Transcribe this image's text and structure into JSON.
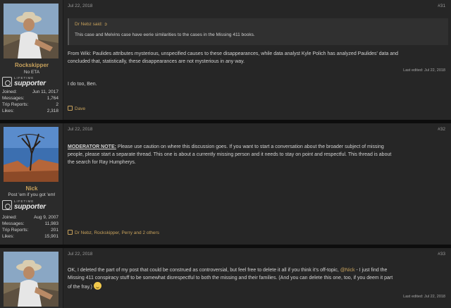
{
  "posts": [
    {
      "user": {
        "name": "Rockskipper",
        "title": "No ETA",
        "badge_top": "LIFETIME",
        "badge_main": "supporter",
        "stats": [
          {
            "label": "Joined:",
            "value": "Jun 11, 2017"
          },
          {
            "label": "Messages:",
            "value": "1,764"
          },
          {
            "label": "Trip Reports:",
            "value": "2"
          },
          {
            "label": "Likes:",
            "value": "2,318"
          }
        ]
      },
      "date": "Jul 22, 2018",
      "number": "#31",
      "quote": {
        "author": "Dr Nebz said:",
        "text": "This case and Melvins case have eerie similarities to the cases in the Missing 411 books."
      },
      "body_lines": [
        "From Wiki: Paulides attributes mysterious, unspecified causes to these disappearances, while data analyst Kyle Polich has analyzed Paulides' data and",
        "concluded that, statistically, these disappearances are not mysterious in any way."
      ],
      "edited": "Last edited: Jul 22, 2018",
      "second_line": "I do too, Ben.",
      "likes": "Dave"
    },
    {
      "user": {
        "name": "Nick",
        "title": "Post 'em if you got 'em!",
        "badge_top": "LIFETIME",
        "badge_main": "supporter",
        "stats": [
          {
            "label": "Joined:",
            "value": "Aug 9, 2007"
          },
          {
            "label": "Messages:",
            "value": "11,983"
          },
          {
            "label": "Trip Reports:",
            "value": "201"
          },
          {
            "label": "Likes:",
            "value": "15,901"
          }
        ]
      },
      "date": "Jul 22, 2018",
      "number": "#32",
      "mod_label": "MODERATOR NOTE:",
      "body_first": " Please use caution on where this discussion goes. If you want to start a conversation about the broader subject of missing",
      "body_lines": [
        "people, please start a separate thread. This one is about a currently missing person and it needs to stay on point and respectful. This thread is about",
        "the search for Ray Humpherys."
      ],
      "likes": "Dr Nebz, Rockskipper, Perry and 2 others"
    },
    {
      "user": {
        "name": "Rockskipper"
      },
      "date": "Jul 22, 2018",
      "number": "#33",
      "body_a": "OK, I deleted the part of my post that could be construed as controversial, but feel free to delete it all if you think it's off-topic, ",
      "mention": "@Nick",
      "body_b": " - I just find the",
      "body_line2": "Missing 411 conspiracy stuff to be somewhat disrespectful to both the missing and their families. (And you can delete this one, too, if you deem it part",
      "body_line3": "of the fray.)",
      "edited": "Last edited: Jul 22, 2018"
    }
  ]
}
